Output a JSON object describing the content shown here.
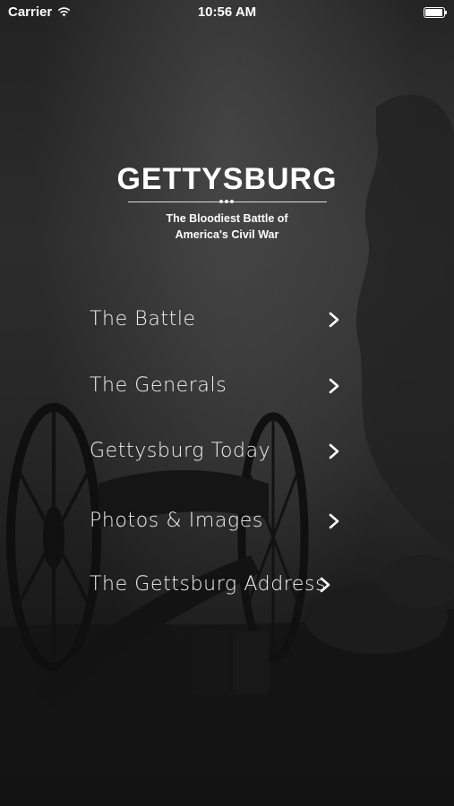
{
  "status_bar": {
    "carrier": "Carrier",
    "time": "10:56 AM"
  },
  "header": {
    "title": "GETTYSBURG",
    "tagline": "The Bloodiest Battle of America's Civil War"
  },
  "menu": {
    "items": [
      {
        "label": "The Battle",
        "icon": "chevron-right-icon"
      },
      {
        "label": "The Generals",
        "icon": "chevron-right-icon"
      },
      {
        "label": "Gettysburg Today",
        "icon": "chevron-right-icon"
      },
      {
        "label": "Photos & Images",
        "icon": "chevron-right-icon"
      },
      {
        "label": "The Gettsburg Address",
        "icon": "chevron-right-icon"
      }
    ]
  },
  "colors": {
    "background": "#1a1a1a",
    "text": "#ffffff"
  }
}
